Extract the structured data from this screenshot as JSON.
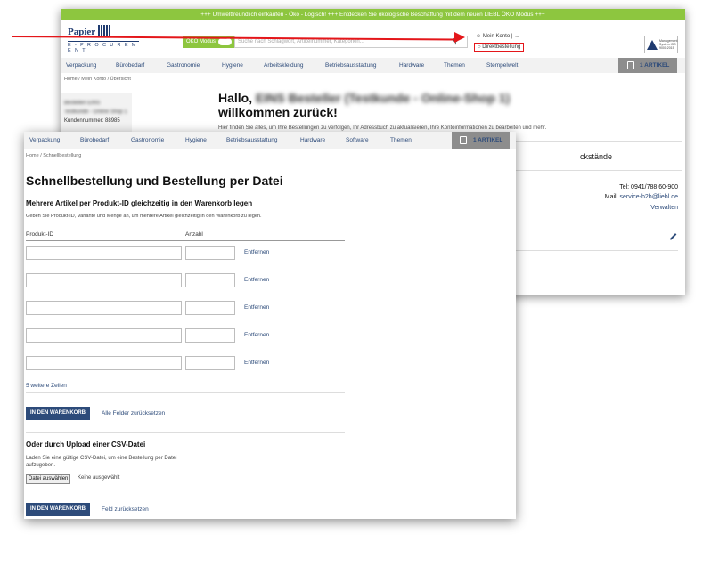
{
  "back_window": {
    "promo": "+++ Umweltfreundlich einkaufen - Öko - Logisch! +++ Entdecken Sie ökologische Beschaffung mit dem neuen LIEBL ÖKO Modus +++",
    "logo_top": "Papier",
    "logo_sub": "E - P R O C U R E M E N T",
    "oko_label": "ÖKO Modus",
    "search_placeholder": "Suche nach Schlagwort, Artikelnummer, Kategorien...",
    "konto_label": "Mein Konto |",
    "direkt_label": "Direktbestellung",
    "cert_text": "Management System ISO 9001:2015",
    "nav": [
      "Verpackung",
      "Bürobedarf",
      "Gastronomie",
      "Hygiene",
      "Arbeitskleidung",
      "Betriebsausstattung",
      "Hardware",
      "Themen",
      "Stempelwelt"
    ],
    "cart_label": "1 ARTIKEL",
    "breadcrumb": "Home / Mein Konto / Übersicht",
    "side_lines": [
      "Bestellen EINS",
      "Testkunde - Online Shop 1",
      "Kundennummer: 88985"
    ],
    "hallo": "Hallo,",
    "hallo_name": "EINS Besteller (Testkunde - Online-Shop 1)",
    "welcome": "willkommen zurück!",
    "hint": "Hier finden Sie alles, um Ihre Bestellungen zu verfolgen, Ihr Adressbuch zu aktualisieren, Ihre Kontoinformationen zu bearbeiten und mehr.",
    "card_text": "ckstände",
    "tel": "Tel: 0941/788 60-900",
    "mail_label": "Mail:",
    "mail": "service-b2b@liebl.de",
    "verwalten": "Verwalten"
  },
  "front_window": {
    "nav": [
      "Verpackung",
      "Bürobedarf",
      "Gastronomie",
      "Hygiene",
      "Betriebsausstattung",
      "Hardware",
      "Software",
      "Themen"
    ],
    "cart_label": "1 ARTIKEL",
    "breadcrumb": "Home / Schnellbestellung",
    "title": "Schnellbestellung und Bestellung per Datei",
    "subtitle": "Mehrere Artikel per Produkt-ID gleichzeitig in den Warenkorb legen",
    "description": "Geben Sie Produkt-ID, Variante und Menge an, um mehrere Artikel gleichzeitig in den Warenkorb zu legen.",
    "col_product": "Produkt-ID",
    "col_qty": "Anzahl",
    "rows": [
      {
        "product": "",
        "qty": "",
        "remove": "Entfernen"
      },
      {
        "product": "",
        "qty": "",
        "remove": "Entfernen"
      },
      {
        "product": "",
        "qty": "",
        "remove": "Entfernen"
      },
      {
        "product": "",
        "qty": "",
        "remove": "Entfernen"
      },
      {
        "product": "",
        "qty": "",
        "remove": "Entfernen"
      }
    ],
    "more_rows": "5 weitere Zeilen",
    "add_to_cart": "IN DEN WARENKORB",
    "reset_all": "Alle Felder zurücksetzen",
    "csv_title": "Oder durch Upload einer CSV-Datei",
    "csv_desc": "Laden Sie eine gültige CSV-Datei, um eine Bestellung per Datei aufzugeben.",
    "file_button": "Datei auswählen",
    "file_none": "Keine ausgewählt",
    "add_to_cart_2": "IN DEN WARENKORB",
    "reset_field": "Feld zurücksetzen"
  },
  "colors": {
    "accent_green": "#8dc63f",
    "brand_blue": "#2d4b7a",
    "arrow_red": "#e4161a"
  }
}
